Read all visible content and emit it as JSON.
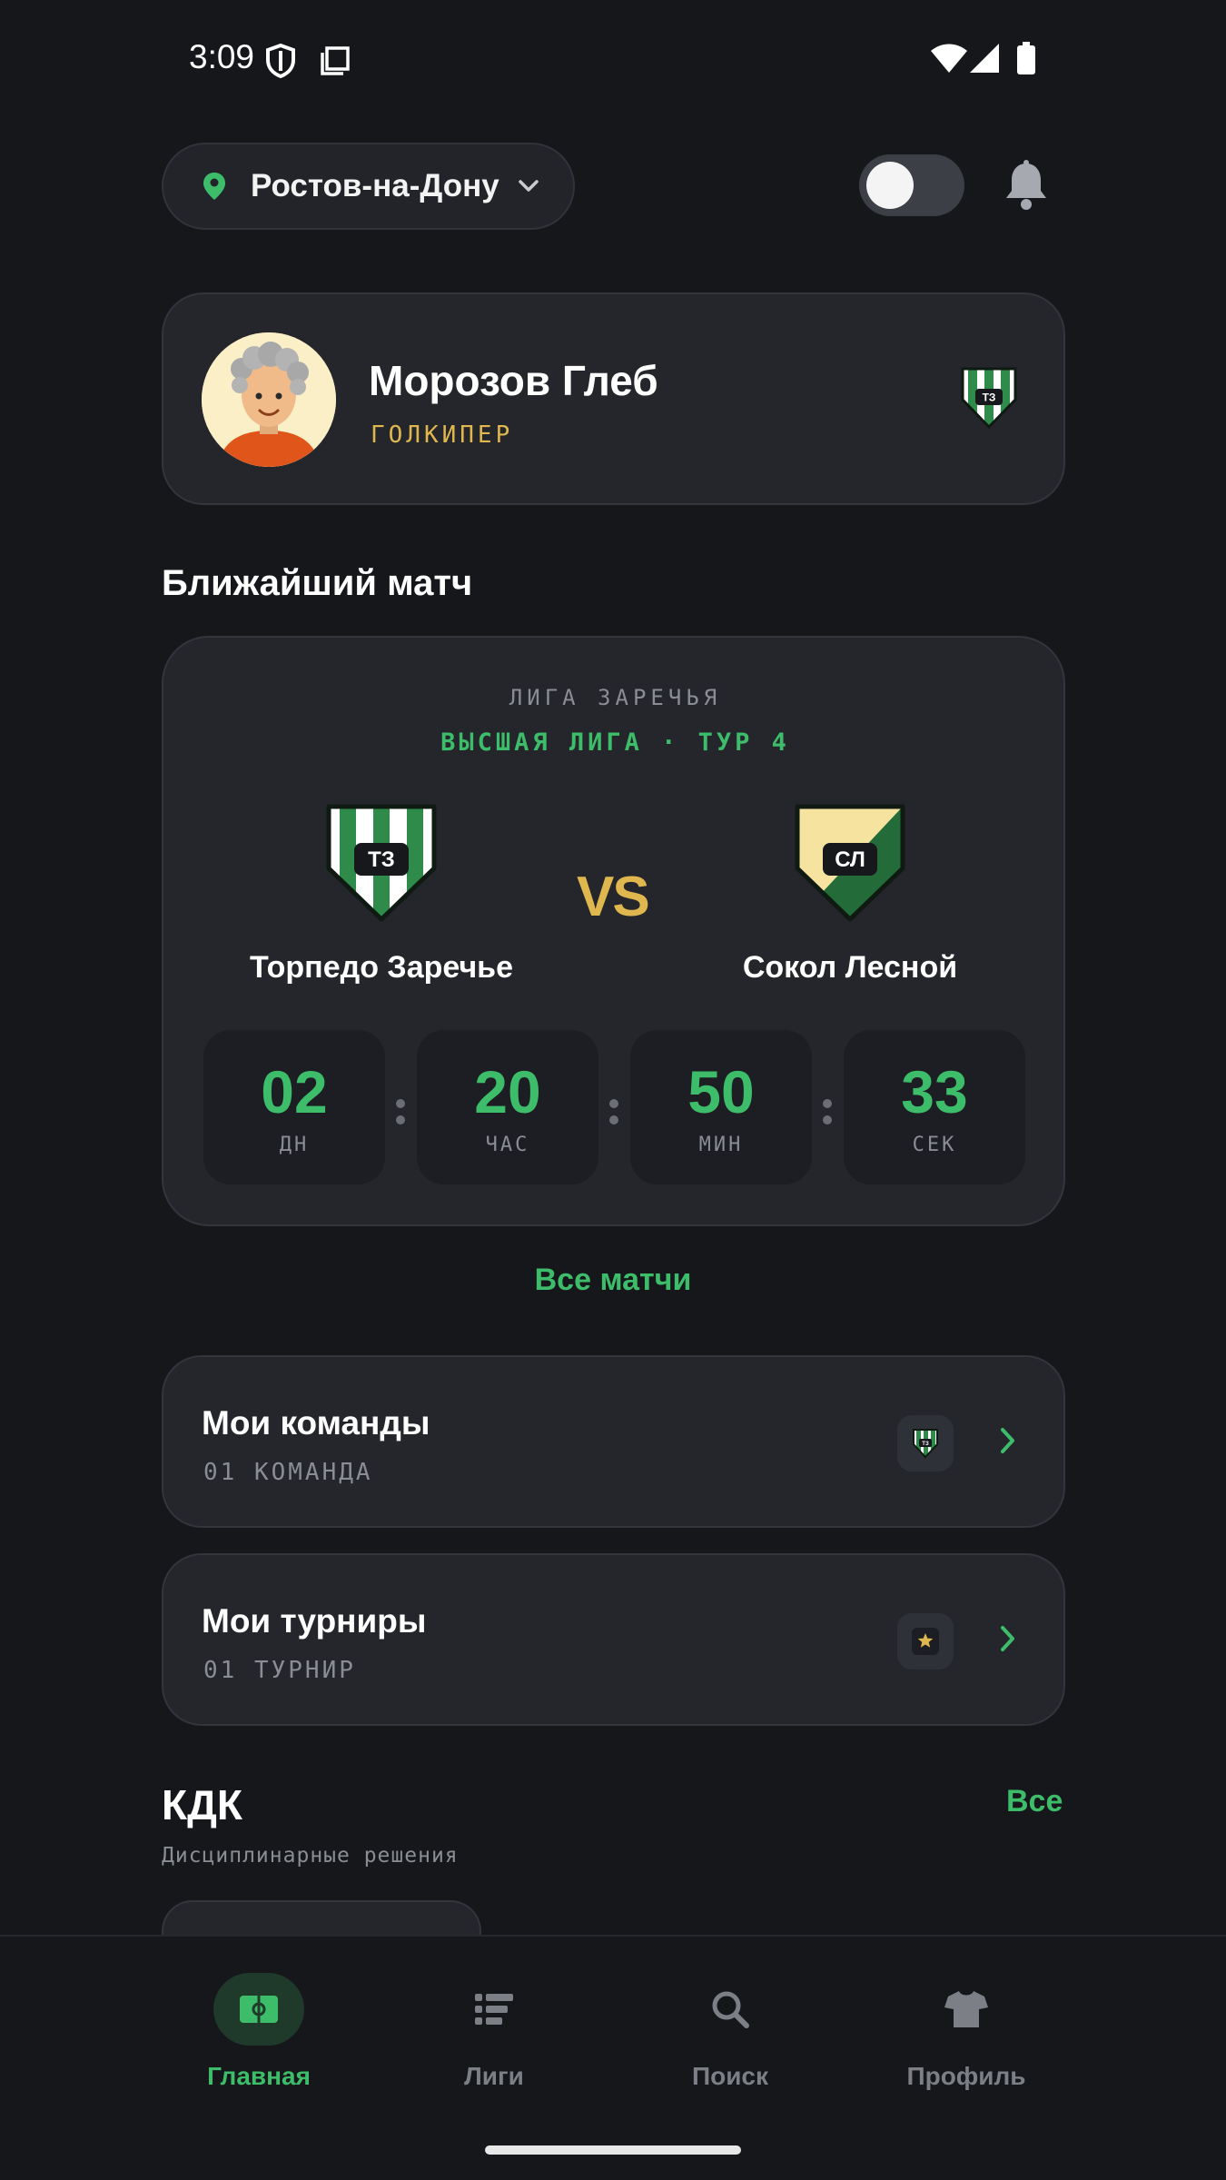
{
  "status_bar": {
    "time": "3:09",
    "icons": [
      "shield-icon",
      "notes-icon",
      "wifi-icon",
      "signal-icon",
      "battery-icon"
    ]
  },
  "header": {
    "city": "Ростов-на-Дону",
    "theme_toggle_on": false
  },
  "profile": {
    "name": "Морозов Глеб",
    "role": "ГОЛКИПЕР",
    "team_badge": "ТЗ"
  },
  "next_match": {
    "section_title": "Ближайший матч",
    "league": "ЛИГА ЗАРЕЧЬЯ",
    "round": "ВЫСШАЯ ЛИГА · ТУР 4",
    "home": {
      "name": "Торпедо Заречье",
      "abbr": "ТЗ"
    },
    "vs": "VS",
    "away": {
      "name": "Сокол Лесной",
      "abbr": "СЛ"
    },
    "countdown": [
      {
        "value": "02",
        "unit": "ДН"
      },
      {
        "value": "20",
        "unit": "ЧАС"
      },
      {
        "value": "50",
        "unit": "МИН"
      },
      {
        "value": "33",
        "unit": "СЕК"
      }
    ],
    "all_matches": "Все матчи"
  },
  "my_teams": {
    "title": "Мои команды",
    "subtitle": "01 КОМАНДА",
    "badge": "ТЗ"
  },
  "my_tournaments": {
    "title": "Мои турниры",
    "subtitle": "01 ТУРНИР"
  },
  "kdk": {
    "title": "КДК",
    "all": "Все",
    "subtitle": "Дисциплинарные решения"
  },
  "bottom_nav": [
    {
      "label": "Главная",
      "icon": "pitch-icon",
      "active": true
    },
    {
      "label": "Лиги",
      "icon": "list-icon",
      "active": false
    },
    {
      "label": "Поиск",
      "icon": "search-icon",
      "active": false
    },
    {
      "label": "Профиль",
      "icon": "shirt-icon",
      "active": false
    }
  ],
  "colors": {
    "background": "#15171b",
    "card": "#24262c",
    "accent_green": "#3dbd6a",
    "accent_gold": "#e0b64e",
    "muted": "#8a8d94"
  }
}
